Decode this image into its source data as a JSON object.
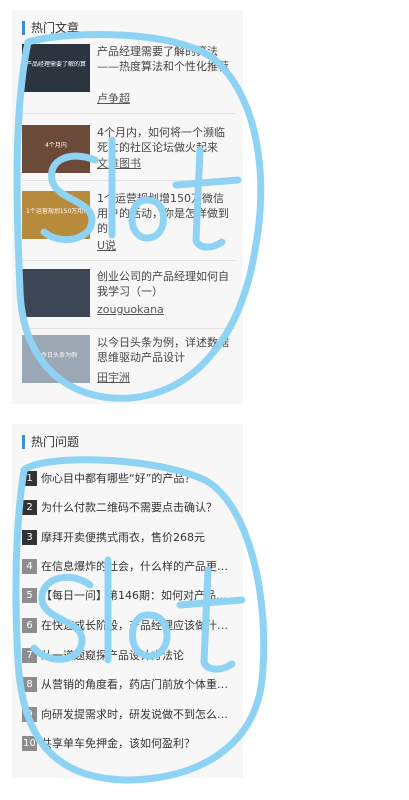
{
  "hot_articles": {
    "title": "热门文章",
    "items": [
      {
        "title": "产品经理需要了解的算法——热度算法和个性化推荐",
        "author": "卢争超",
        "thumb_caption": "产品经理需要了解的算法",
        "thumb_color": "#2c3440"
      },
      {
        "title": "4个月内，如何将一个濒临死亡的社区论坛做火起来",
        "author": "文章图书",
        "thumb_caption": "4个月内",
        "thumb_color": "#6b4a3a"
      },
      {
        "title": "1个运营规划增150万微信用户的活动，你是怎样做到的？",
        "author": "U说",
        "thumb_caption": "1个运营规划150万用户",
        "thumb_color": "#b88a3b"
      },
      {
        "title": "创业公司的产品经理如何自我学习（一）",
        "author": "zouguokana",
        "thumb_caption": "",
        "thumb_color": "#3d4654"
      },
      {
        "title": "以今日头条为例，详述数据思维驱动产品设计",
        "author": "田宇洲",
        "thumb_caption": "以今日头条为例",
        "thumb_color": "#9aa7b4"
      }
    ]
  },
  "hot_questions": {
    "title": "热门问题",
    "items": [
      {
        "num": "1",
        "text": "你心目中都有哪些“好”的产品？"
      },
      {
        "num": "2",
        "text": "为什么付款二维码不需要点击确认？"
      },
      {
        "num": "3",
        "text": "摩拜开卖便携式雨衣，售价268元"
      },
      {
        "num": "4",
        "text": "在信息爆炸的社会，什么样的产品更吸引人？"
      },
      {
        "num": "5",
        "text": "【每日一问】第146期：如何对产品做规划？"
      },
      {
        "num": "6",
        "text": "在快速成长阶段，产品经理应该做什么？"
      },
      {
        "num": "7",
        "text": "从一道题窥探产品设计方法论"
      },
      {
        "num": "8",
        "text": "从营销的角度看，药店门前放个体重秤？"
      },
      {
        "num": "9",
        "text": "向研发提需求时，研发说做不到怎么办？"
      },
      {
        "num": "10",
        "text": "共享单车免押金，该如何盈利？"
      }
    ]
  },
  "annotations": {
    "upper_label": "Slot",
    "lower_label": "Slot",
    "color": "#8fd3f4"
  }
}
